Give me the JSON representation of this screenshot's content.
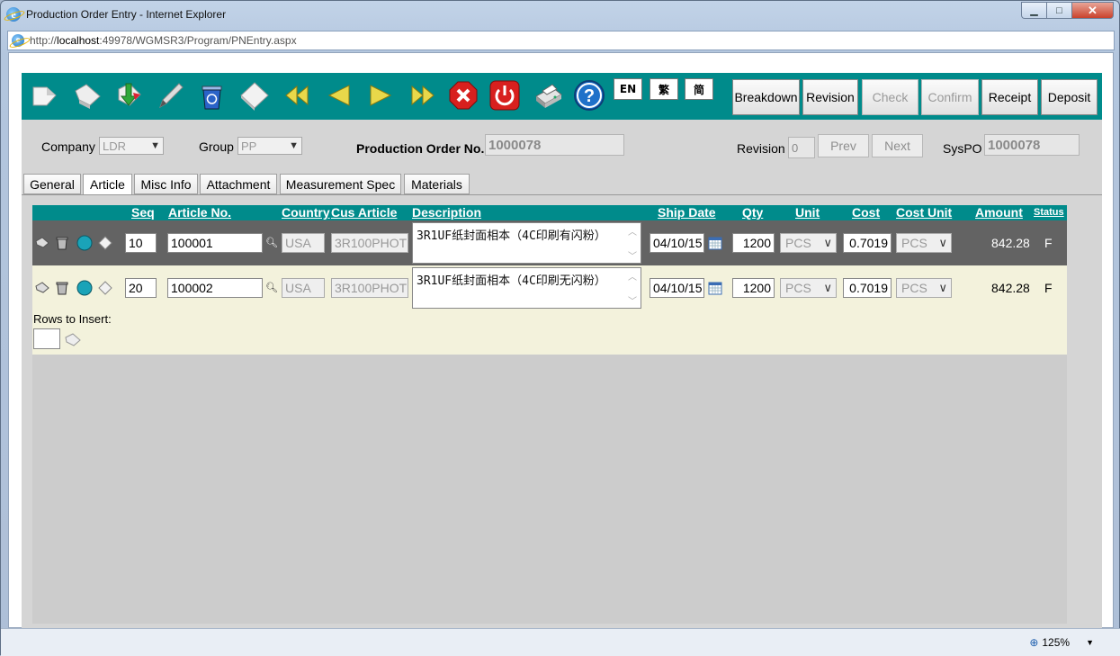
{
  "window": {
    "title": "Production Order Entry - Internet Explorer",
    "min": "▁",
    "max": "□",
    "close": "✕"
  },
  "address": {
    "prefix": "http://",
    "host": "localhost",
    "path": ":49978/WGMSR3/Program/PNEntry.aspx"
  },
  "toolbar": {
    "icons": [
      "new-doc-icon",
      "copy-doc-icon",
      "import-export-icon",
      "edit-pencil-icon",
      "recycle-bin-icon",
      "diamond-icon",
      "first-record-icon",
      "previous-record-icon",
      "next-record-icon",
      "last-record-icon",
      "cancel-icon",
      "power-exit-icon",
      "print-icon",
      "help-icon"
    ],
    "lang": {
      "en": "EN",
      "tc": "繁",
      "sc": "简"
    },
    "buttons": {
      "breakdown": "Breakdown",
      "revision": "Revision",
      "check": "Check",
      "confirm": "Confirm",
      "receipt": "Receipt",
      "deposit": "Deposit"
    }
  },
  "header": {
    "company_label": "Company",
    "company_value": "LDR",
    "group_label": "Group",
    "group_value": "PP",
    "po_label": "Production Order No.",
    "po_value": "1000078",
    "revision_label": "Revision",
    "revision_value": "0",
    "prev": "Prev",
    "next": "Next",
    "syspo_label": "SysPO",
    "syspo_value": "1000078"
  },
  "tabs": [
    "General",
    "Article",
    "Misc Info",
    "Attachment",
    "Measurement Spec",
    "Materials"
  ],
  "grid": {
    "headers": {
      "seq": "Seq",
      "article": "Article No.",
      "country": "Country",
      "cus_article": "Cus Article",
      "description": "Description",
      "ship_date": "Ship Date",
      "qty": "Qty",
      "unit": "Unit",
      "cost": "Cost",
      "cost_unit": "Cost Unit",
      "amount": "Amount",
      "status": "Status"
    },
    "rows": [
      {
        "seq": "10",
        "article": "100001",
        "country": "USA",
        "cus_article": "3R100PHOT",
        "description": "3R1UF纸封面相本（4C印刷有闪粉）",
        "ship_date": "04/10/15",
        "qty": "1200",
        "unit": "PCS",
        "cost": "0.7019",
        "cost_unit": "PCS",
        "amount": "842.28",
        "status": "F"
      },
      {
        "seq": "20",
        "article": "100002",
        "country": "USA",
        "cus_article": "3R100PHOT",
        "description": "3R1UF纸封面相本（4C印刷无闪粉）",
        "ship_date": "04/10/15",
        "qty": "1200",
        "unit": "PCS",
        "cost": "0.7019",
        "cost_unit": "PCS",
        "amount": "842.28",
        "status": "F"
      }
    ],
    "rows_to_insert_label": "Rows to Insert:"
  },
  "statusbar": {
    "zoom": "125%"
  }
}
